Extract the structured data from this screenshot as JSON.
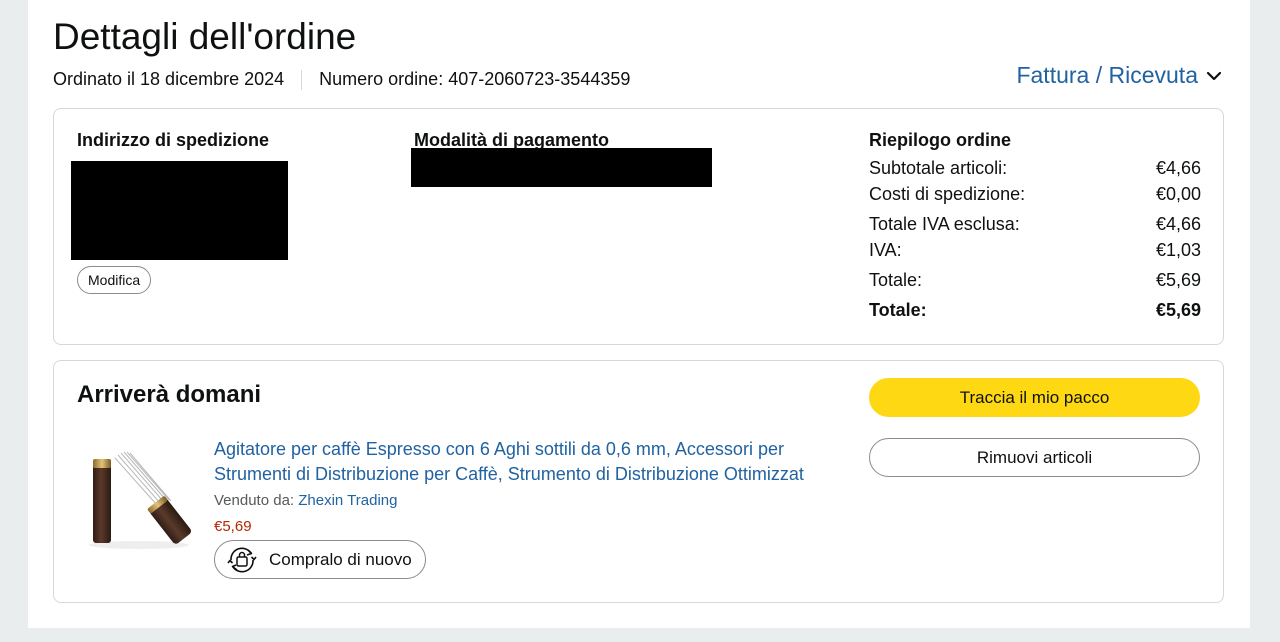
{
  "page": {
    "title": "Dettagli dell'ordine",
    "ordered_on": "Ordinato il 18 dicembre 2024",
    "order_number": "Numero ordine: 407-2060723-3544359",
    "invoice_label": "Fattura / Ricevuta"
  },
  "details": {
    "shipping_heading": "Indirizzo di spedizione",
    "edit_label": "Modifica",
    "payment_heading": "Modalità di pagamento"
  },
  "summary": {
    "heading": "Riepilogo ordine",
    "rows": [
      {
        "label": "Subtotale articoli:",
        "value": "€4,66"
      },
      {
        "label": "Costi di spedizione:",
        "value": "€0,00"
      },
      {
        "label": "Totale IVA esclusa:",
        "value": "€4,66"
      },
      {
        "label": "IVA:",
        "value": "€1,03"
      },
      {
        "label": "Totale:",
        "value": "€5,69"
      },
      {
        "label": "Totale:",
        "value": "€5,69"
      }
    ]
  },
  "shipment": {
    "status": "Arriverà domani",
    "product_title": "Agitatore per caffè Espresso con 6 Aghi sottili da 0,6 mm, Accessori per Strumenti di Distribuzione per Caffè, Strumento di Distribuzione Ottimizzat",
    "sold_by_label": "Venduto da:",
    "seller": "Zhexin Trading",
    "price": "€5,69",
    "buy_again_label": "Compralo di nuovo",
    "track_label": "Traccia il mio pacco",
    "remove_label": "Rimuovi articoli"
  },
  "colors": {
    "link": "#2162a1",
    "price": "#b12704",
    "primary_button": "#ffd814"
  }
}
